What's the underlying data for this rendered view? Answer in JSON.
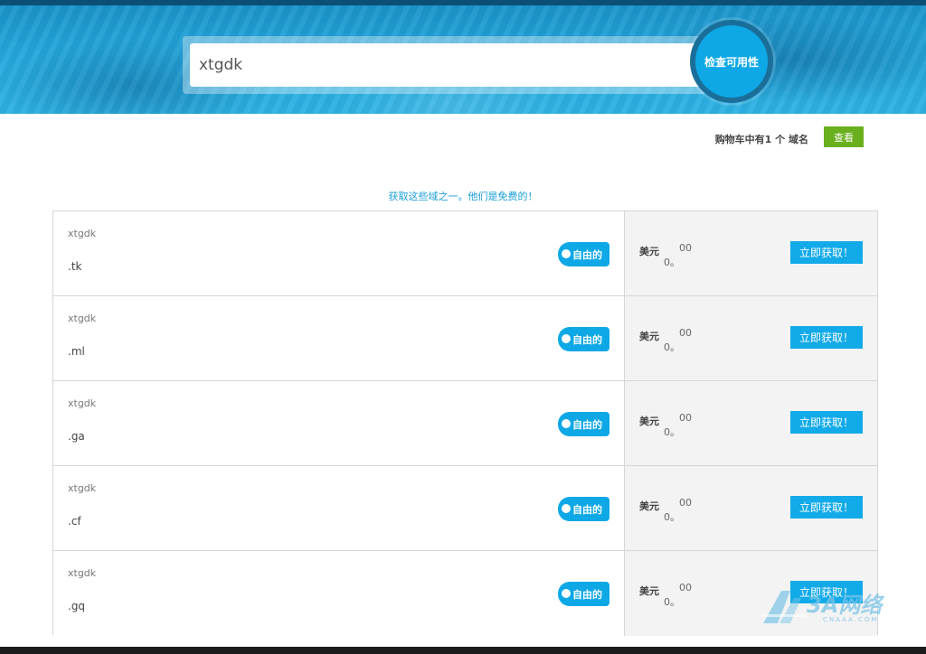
{
  "search": {
    "value": "xtgdk",
    "button_label": "检查可用性"
  },
  "cart": {
    "text": "购物车中有1 个 域名",
    "view_label": "查看"
  },
  "promo": "获取这些域之一。他们是免费的！",
  "domains": [
    {
      "name": "xtgdk",
      "tld": ".tk",
      "badge": "自由的",
      "currency": "美元",
      "price_int": "0。",
      "price_dec": "00",
      "button": "立即获取！"
    },
    {
      "name": "xtgdk",
      "tld": ".ml",
      "badge": "自由的",
      "currency": "美元",
      "price_int": "0。",
      "price_dec": "00",
      "button": "立即获取！"
    },
    {
      "name": "xtgdk",
      "tld": ".ga",
      "badge": "自由的",
      "currency": "美元",
      "price_int": "0。",
      "price_dec": "00",
      "button": "立即获取！"
    },
    {
      "name": "xtgdk",
      "tld": ".cf",
      "badge": "自由的",
      "currency": "美元",
      "price_int": "0。",
      "price_dec": "00",
      "button": "立即获取！"
    },
    {
      "name": "xtgdk",
      "tld": ".gq",
      "badge": "自由的",
      "currency": "美元",
      "price_int": "0。",
      "price_dec": "00",
      "button": "立即获取！"
    }
  ],
  "watermark": {
    "text": "3A网络",
    "sub": "CNAAA.COM"
  },
  "colors": {
    "accent": "#0ea8e6",
    "view_button": "#6aaf1e",
    "hero": "#25a7dc"
  }
}
